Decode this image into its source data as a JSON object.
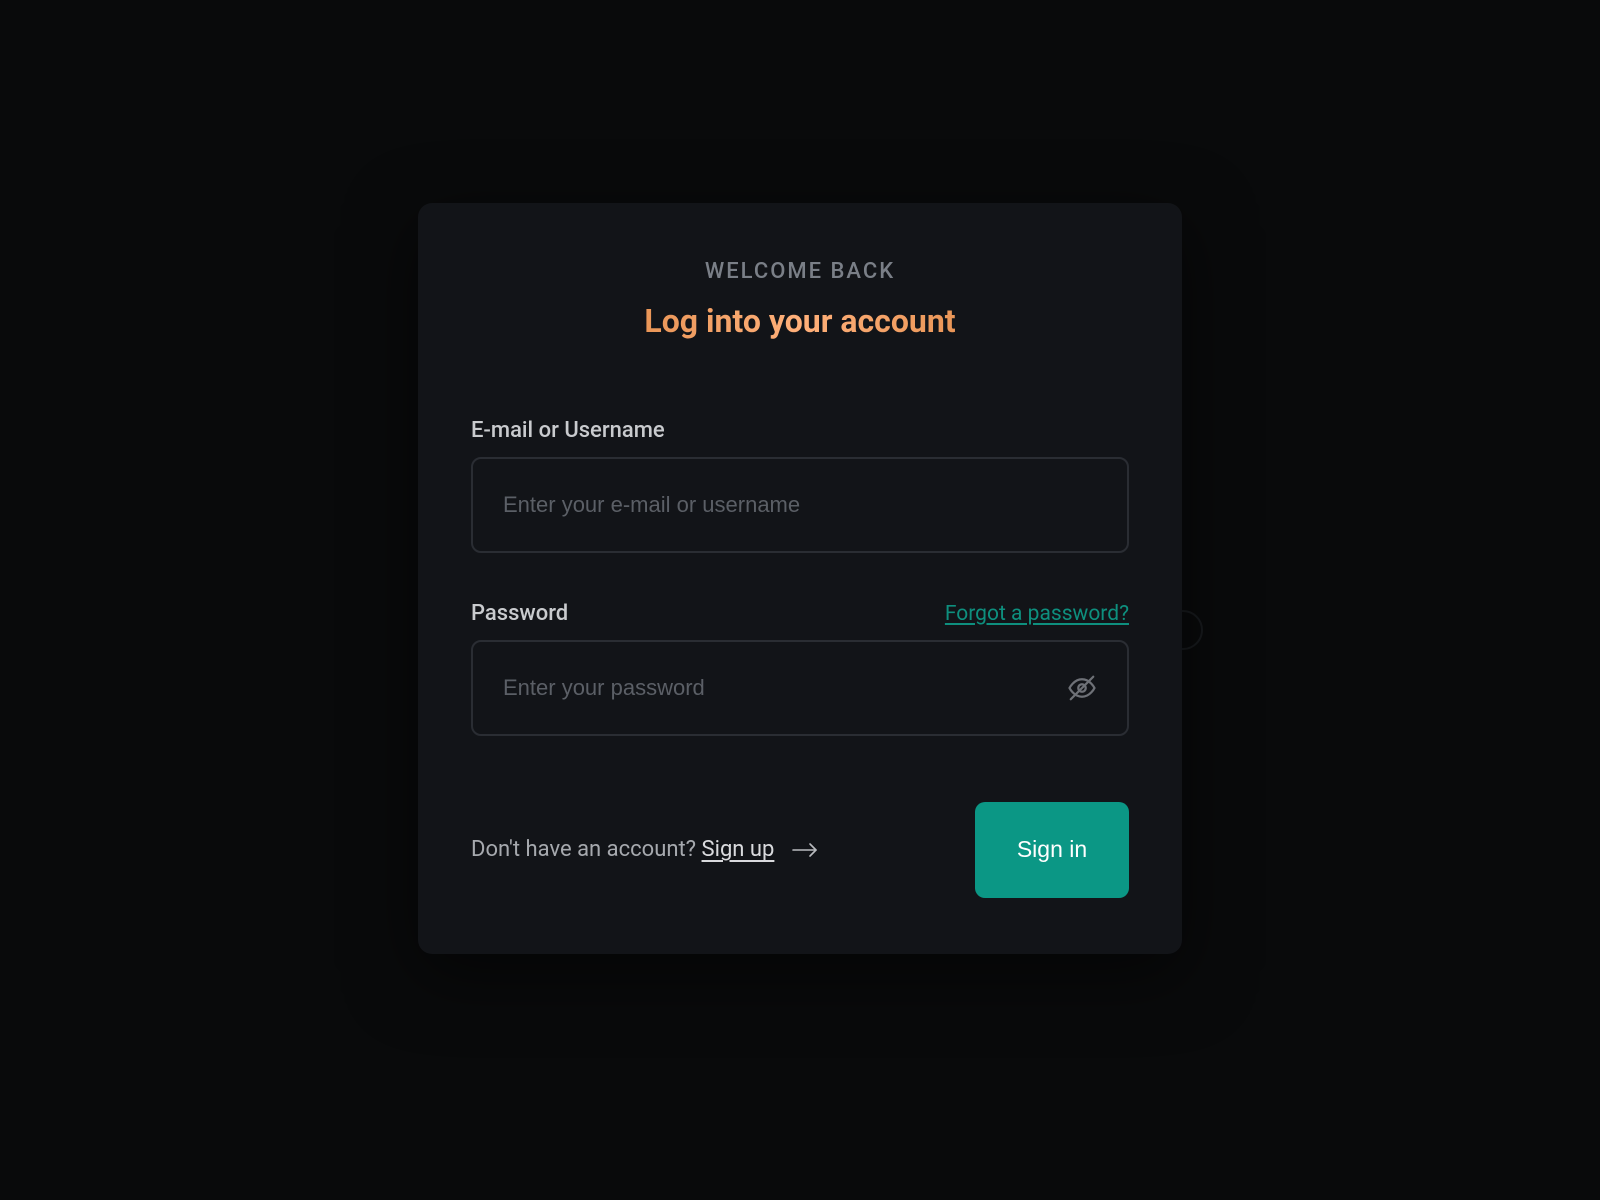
{
  "card": {
    "eyebrow": "WELCOME BACK",
    "heading": "Log into your account"
  },
  "fields": {
    "email": {
      "label": "E-mail or Username",
      "placeholder": "Enter your e-mail or username",
      "value": ""
    },
    "password": {
      "label": "Password",
      "placeholder": "Enter your password",
      "value": "",
      "forgot_link": "Forgot a password?"
    }
  },
  "footer": {
    "signup_prompt": "Don't have an account? ",
    "signup_link": "Sign up",
    "signin_label": "Sign in"
  },
  "icons": {
    "password_toggle": "eye-off-icon",
    "arrow": "arrow-right-icon"
  },
  "colors": {
    "page_bg": "#090A0B",
    "card_bg": "#121418",
    "heading_gradient_start": "#d27931",
    "heading_gradient_end": "#ffb07a",
    "accent_teal": "#0b9785",
    "link_teal": "#0e8f7e",
    "muted_text": "#7a7f87",
    "label_text": "#c9cbce",
    "border": "#2a2d33"
  }
}
